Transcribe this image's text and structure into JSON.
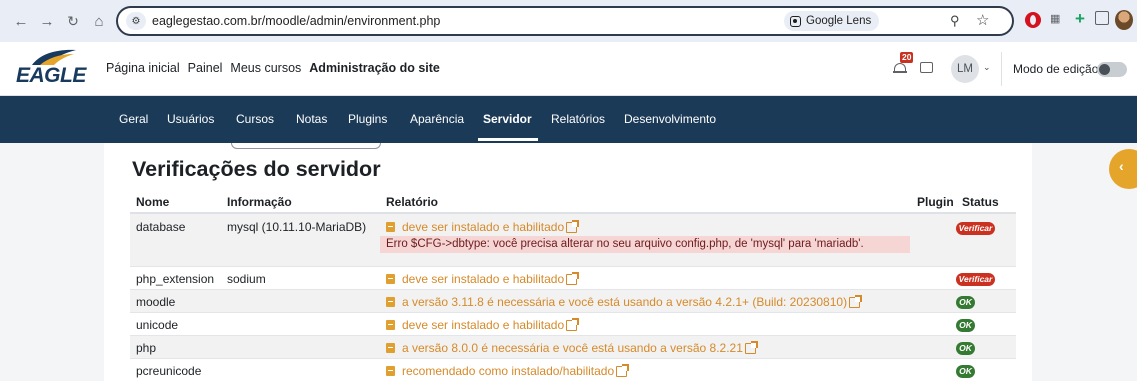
{
  "browser": {
    "url": "eaglegestao.com.br/moodle/admin/environment.php",
    "lens_label": "Google Lens"
  },
  "logo_text": "EAGLE",
  "primary_nav": [
    {
      "label": "Página inicial",
      "active": false
    },
    {
      "label": "Painel",
      "active": false
    },
    {
      "label": "Meus cursos",
      "active": false
    },
    {
      "label": "Administração do site",
      "active": true
    }
  ],
  "notifications": {
    "count": "20"
  },
  "user": {
    "initials": "LM"
  },
  "edit_mode": {
    "label": "Modo de edição",
    "on": false
  },
  "secondary_nav": [
    {
      "label": "Geral",
      "active": false
    },
    {
      "label": "Usuários",
      "active": false
    },
    {
      "label": "Cursos",
      "active": false
    },
    {
      "label": "Notas",
      "active": false
    },
    {
      "label": "Plugins",
      "active": false
    },
    {
      "label": "Aparência",
      "active": false
    },
    {
      "label": "Servidor",
      "active": true
    },
    {
      "label": "Relatórios",
      "active": false
    },
    {
      "label": "Desenvolvimento",
      "active": false
    }
  ],
  "page": {
    "title": "Verificações do servidor"
  },
  "table": {
    "headers": {
      "name": "Nome",
      "info": "Informação",
      "report": "Relatório",
      "plugin": "Plugin",
      "status": "Status"
    },
    "rows": [
      {
        "name": "database",
        "info": "mysql (10.11.10-MariaDB)",
        "report": "deve ser instalado e habilitado",
        "error": "Erro $CFG->dbtype: você precisa alterar no seu arquivo config.php, de 'mysql' para 'mariadb'.",
        "status": "Verificar",
        "status_type": "warn"
      },
      {
        "name": "php_extension",
        "info": "sodium",
        "report": "deve ser instalado e habilitado",
        "status": "Verificar",
        "status_type": "warn"
      },
      {
        "name": "moodle",
        "info": "",
        "report": "a versão 3.11.8 é necessária e você está usando a versão 4.2.1+ (Build: 20230810)",
        "status": "OK",
        "status_type": "ok"
      },
      {
        "name": "unicode",
        "info": "",
        "report": "deve ser instalado e habilitado",
        "status": "OK",
        "status_type": "ok"
      },
      {
        "name": "php",
        "info": "",
        "report": "a versão 8.0.0 é necessária e você está usando a versão 8.2.21",
        "status": "OK",
        "status_type": "ok"
      },
      {
        "name": "pcreunicode",
        "info": "",
        "report": "recomendado como instalado/habilitado",
        "status": "OK",
        "status_type": "ok"
      }
    ]
  },
  "colors": {
    "nav_bg": "#1b3a57",
    "report_text": "#d68a2a",
    "badge_warn": "#ca3120",
    "badge_ok": "#357a32",
    "drawer": "#e5a52b"
  }
}
